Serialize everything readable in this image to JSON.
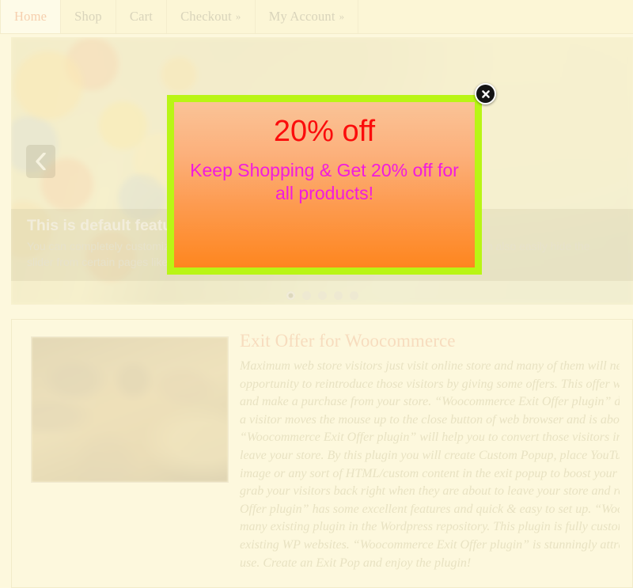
{
  "nav": {
    "items": [
      {
        "label": "Home",
        "active": true,
        "caret": ""
      },
      {
        "label": "Shop",
        "active": false,
        "caret": ""
      },
      {
        "label": "Cart",
        "active": false,
        "caret": ""
      },
      {
        "label": "Checkout",
        "active": false,
        "caret": "»"
      },
      {
        "label": "My Account",
        "active": false,
        "caret": "»"
      }
    ]
  },
  "slider": {
    "prev_icon": "chevron-left-icon",
    "caption_title": "This is default featured slide 1 title",
    "caption_text": "You can completely customize the featured slides from the theme theme options page. You can also easily hide the slider from certain pages like: categories, tags, archives etc. Read More",
    "caption_link_label": "Read More",
    "dots": [
      {
        "index": "1",
        "active": true
      },
      {
        "index": "2",
        "active": false
      },
      {
        "index": "3",
        "active": false
      },
      {
        "index": "4",
        "active": false
      },
      {
        "index": "5",
        "active": false
      }
    ]
  },
  "post": {
    "thumb_alt": "women-meeting-around-table-photo",
    "title": "Exit Offer for Woocommerce",
    "body_lines": [
      "Maximum web store visitors just visit online store and many of them will never return again. There is only one",
      "opportunity to reintroduce those visitors by giving some offers. This offer will encourage them to stay longer",
      "and make a purchase from your store. “Woocommerce Exit Offer plugin” displays a custom popup message when",
      "a visitor moves the mouse up to the close button of web browser and is about to leave your online store.",
      "“Woocommerce Exit Offer plugin” will help you to convert those visitors into customers before they actually",
      "leave your store. By this plugin you will create Custom Popup, place YouTube/Vimeo video, custom form, banner",
      "image or any sort of HTML/custom content in the exit popup to boost your sales increment. “Woocommerce Exit Offer plugin” helps to",
      "grab your visitors back right when they are about to leave your store and recover sales which you would otherwise lose. “Woocommerce Exit",
      "Offer plugin” has some excellent features and quick & easy to set up. “Woocommerce Exit Offer plugin” is more flexible and easy to use than",
      "many existing plugin in the Wordpress repository. This plugin is fully customizable. Users can easily configure the plugin in their new or",
      "existing WP websites. “Woocommerce Exit Offer plugin” is stunningly attractive in design whatever you want. It’s really awesome & easy to",
      "use. Create an Exit Pop and enjoy the plugin!"
    ]
  },
  "popup": {
    "heading": "20% off",
    "subtext": "Keep Shopping & Get 20% off for all products!",
    "close_icon": "close-x-icon",
    "colors": {
      "border": "#b9f515",
      "gradient_top": "#fac397",
      "gradient_bottom": "#fe861f",
      "heading_color": "#fb0c0b",
      "subtext_color": "#f21bde"
    }
  }
}
